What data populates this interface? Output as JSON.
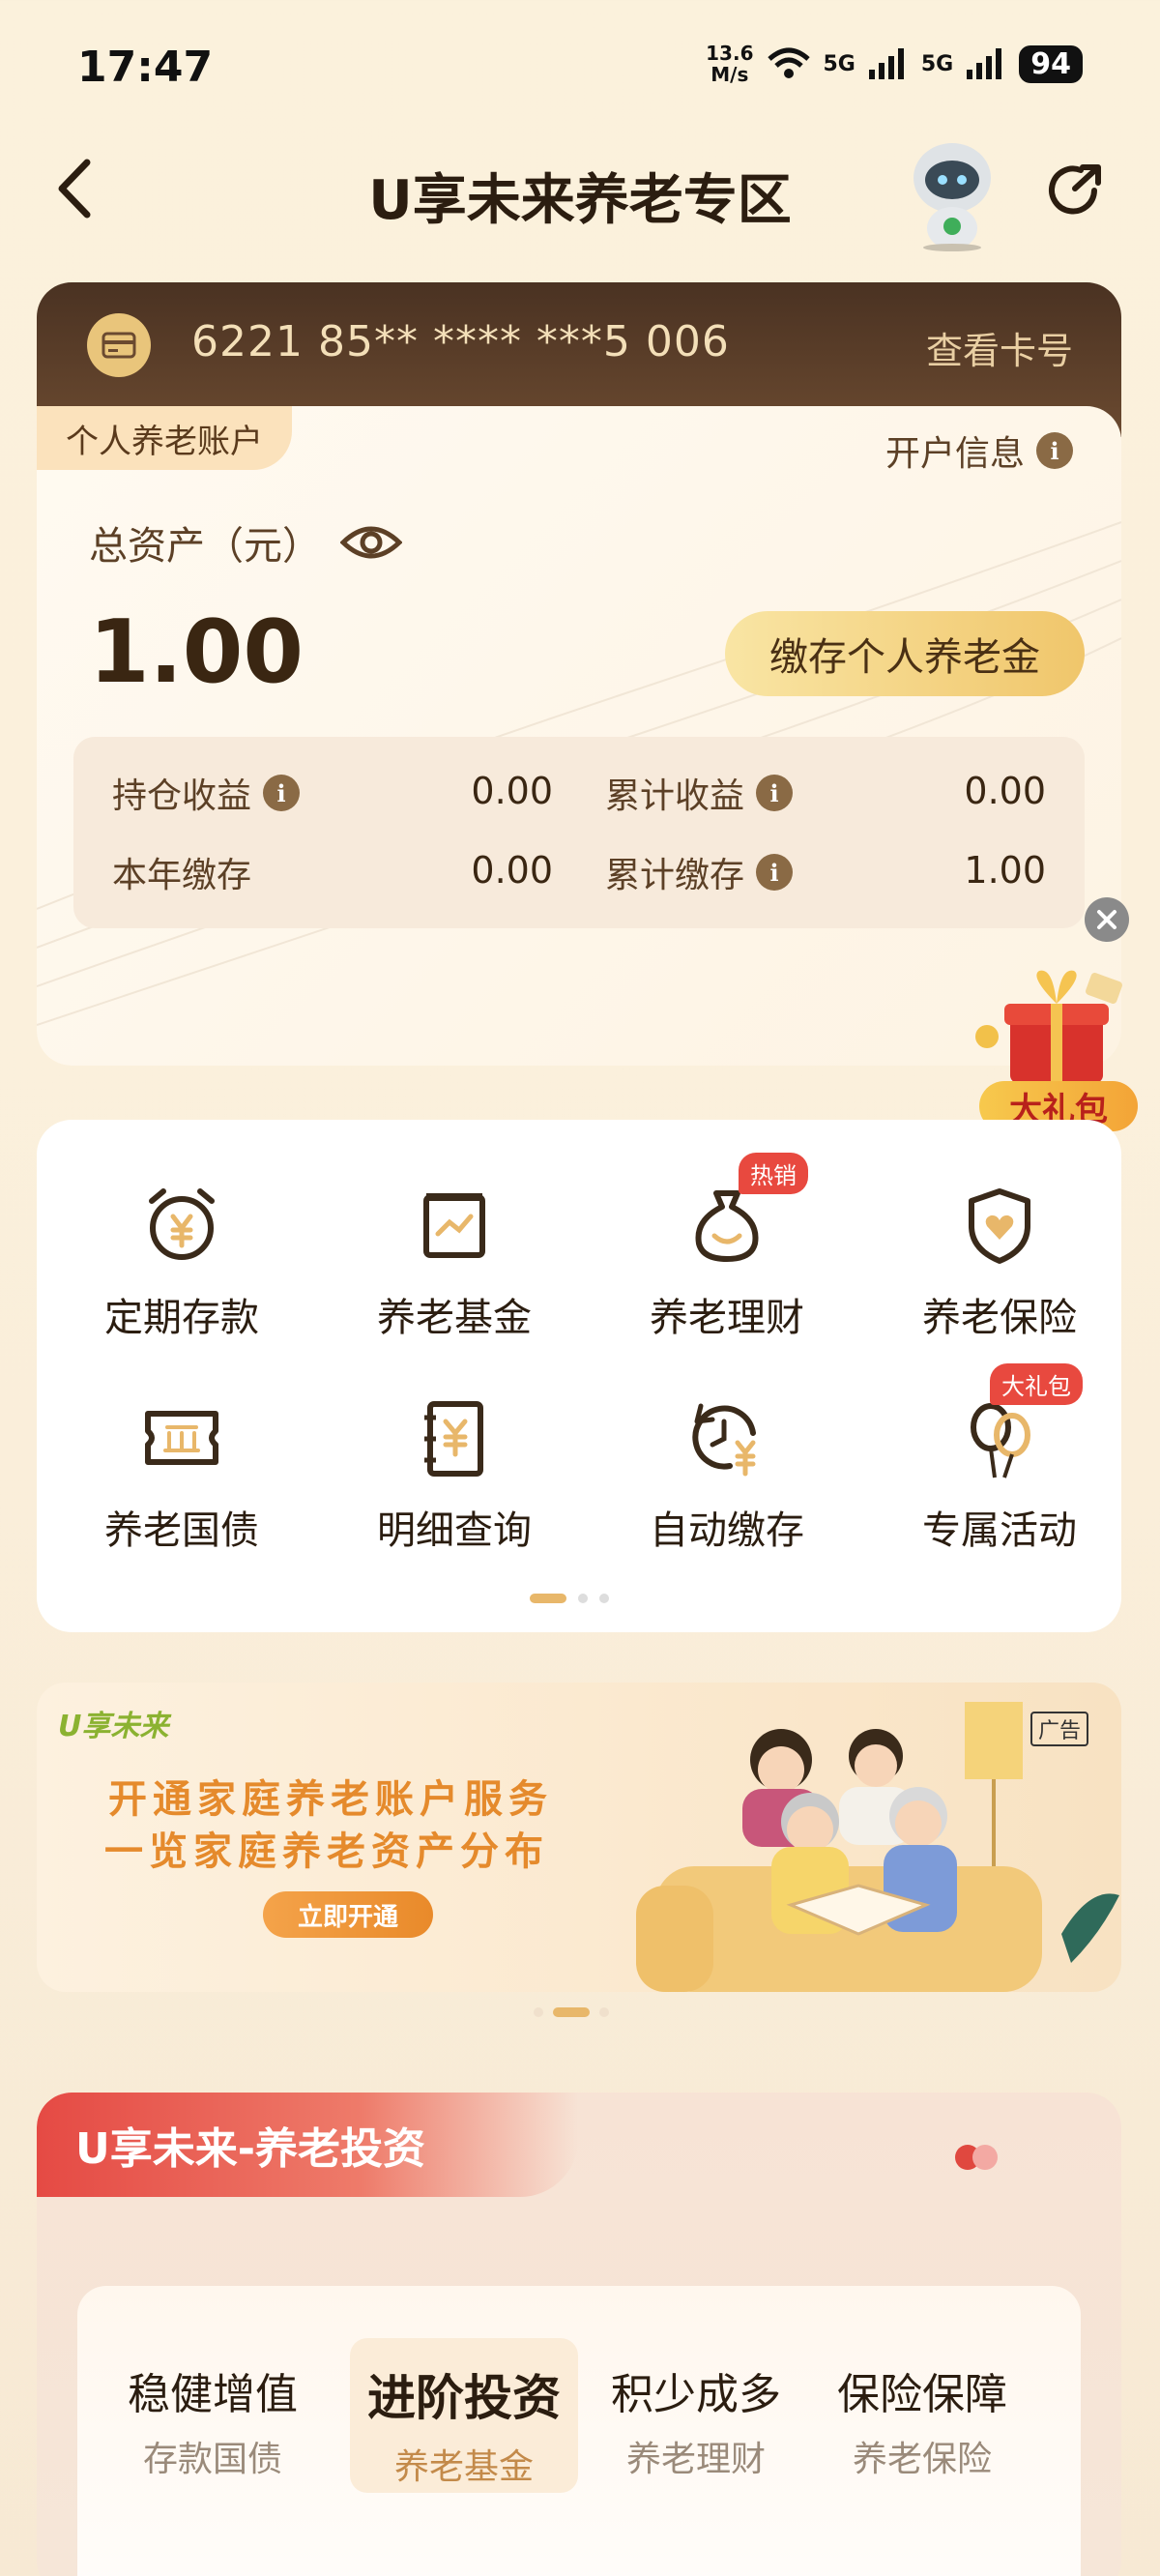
{
  "status_bar": {
    "time": "17:47",
    "net_speed_top": "13.6",
    "net_speed_unit": "M/s",
    "signal1": "5G",
    "signal2": "5G",
    "battery": "94"
  },
  "nav": {
    "title": "U享未来养老专区"
  },
  "card": {
    "number": "6221 85** **** ***5 006",
    "view_card_label": "查看卡号",
    "account_tag": "个人养老账户",
    "open_info_label": "开户信息",
    "total_assets_label": "总资产（元）",
    "total_assets_value": "1.00",
    "deposit_button": "缴存个人养老金",
    "stats": {
      "holding_income_label": "持仓收益",
      "holding_income_value": "0.00",
      "cumulative_income_label": "累计收益",
      "cumulative_income_value": "0.00",
      "year_deposit_label": "本年缴存",
      "year_deposit_value": "0.00",
      "cumulative_deposit_label": "累计缴存",
      "cumulative_deposit_value": "1.00"
    }
  },
  "gift": {
    "label": "大礼包"
  },
  "services": [
    {
      "label": "定期存款",
      "icon": "alarm-yuan-icon"
    },
    {
      "label": "养老基金",
      "icon": "fund-chart-icon"
    },
    {
      "label": "养老理财",
      "icon": "money-bag-icon",
      "badge": "热销"
    },
    {
      "label": "养老保险",
      "icon": "shield-heart-icon"
    },
    {
      "label": "养老国债",
      "icon": "bond-ticket-icon"
    },
    {
      "label": "明细查询",
      "icon": "receipt-yuan-icon"
    },
    {
      "label": "自动缴存",
      "icon": "clock-yuan-icon"
    },
    {
      "label": "专属活动",
      "icon": "balloons-icon",
      "badge": "大礼包"
    }
  ],
  "banner": {
    "logo": "U享未来",
    "line1": "开通家庭养老账户服务",
    "line2": "一览家庭养老资产分布",
    "button": "立即开通",
    "ad_tag": "广告"
  },
  "invest": {
    "title": "U享未来-养老投资",
    "tabs": [
      {
        "main": "稳健增值",
        "sub": "存款国债"
      },
      {
        "main": "进阶投资",
        "sub": "养老基金"
      },
      {
        "main": "积少成多",
        "sub": "养老理财"
      },
      {
        "main": "保险保障",
        "sub": "养老保险"
      }
    ]
  },
  "colors": {
    "accent": "#e8b76a",
    "brand_red": "#e54a44",
    "card_dark": "#4a3222",
    "badge_red": "#e8493f"
  }
}
